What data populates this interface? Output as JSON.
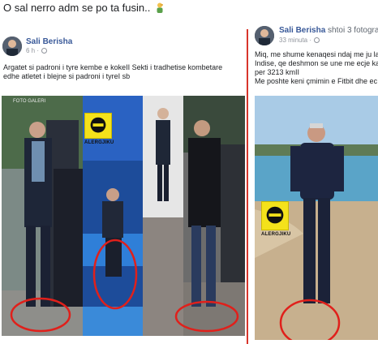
{
  "caption": {
    "text": "O sal nerro adm se po ta fusin..",
    "emoji": "person-facepalming-icon"
  },
  "post_left": {
    "author": "Sali Berisha",
    "time": "6 h",
    "text_lines": [
      "Argatet si padroni i tyre kembe e kokeII Sekti i tradhetise kombetare",
      "edhe atletet i blejne si padroni i tyreI sb"
    ],
    "photo_watermark": "FOTO GALERI",
    "logo_text": "ALERGJIKU"
  },
  "post_right": {
    "author": "Sali Berisha",
    "shared_text": "shtoi 3 fotografi t",
    "time": "33 minuta",
    "text_lines": [
      "Miq, me shume kenaqesi ndaj me ju la",
      "Indise, qe deshmon se une me ecje ka",
      "per 3213 kmII",
      "Me poshte keni çmimin e Fitbit dhe ec"
    ],
    "logo_text": "ALERGJIKU"
  },
  "colors": {
    "link_blue": "#385898",
    "red_circle": "#e0201b",
    "badge_yellow": "#f4e21b",
    "divider_red": "#d8352b"
  }
}
